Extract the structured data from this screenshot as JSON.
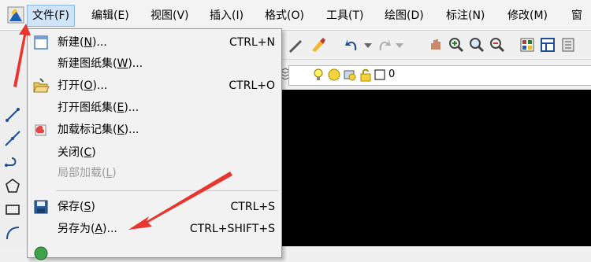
{
  "menubar": {
    "app_icon": "autocad-app-icon",
    "items": [
      {
        "label": "文件(F)"
      },
      {
        "label": "编辑(E)"
      },
      {
        "label": "视图(V)"
      },
      {
        "label": "插入(I)"
      },
      {
        "label": "格式(O)"
      },
      {
        "label": "工具(T)"
      },
      {
        "label": "绘图(D)"
      },
      {
        "label": "标注(N)"
      },
      {
        "label": "修改(M)"
      },
      {
        "label": "窗"
      }
    ]
  },
  "layer_toolbar": {
    "layer_name": "0"
  },
  "file_menu": {
    "items": [
      {
        "pre": "新建(",
        "key": "N",
        "post": ")...",
        "shortcut": "CTRL+N",
        "icon": "new-file-icon",
        "enabled": true
      },
      {
        "pre": "新建图纸集(",
        "key": "W",
        "post": ")...",
        "shortcut": "",
        "icon": "",
        "enabled": true
      },
      {
        "pre": "打开(",
        "key": "O",
        "post": ")...",
        "shortcut": "CTRL+O",
        "icon": "open-folder-icon",
        "enabled": true
      },
      {
        "pre": "打开图纸集(",
        "key": "E",
        "post": ")...",
        "shortcut": "",
        "icon": "",
        "enabled": true
      },
      {
        "pre": "加载标记集(",
        "key": "K",
        "post": ")...",
        "shortcut": "",
        "icon": "markup-set-icon",
        "enabled": true
      },
      {
        "pre": "关闭(",
        "key": "C",
        "post": ")",
        "shortcut": "",
        "icon": "",
        "enabled": true
      },
      {
        "pre": "局部加载(",
        "key": "L",
        "post": ")",
        "shortcut": "",
        "icon": "",
        "enabled": false
      },
      {
        "pre": "保存(",
        "key": "S",
        "post": ")",
        "shortcut": "CTRL+S",
        "icon": "save-disk-icon",
        "enabled": true
      },
      {
        "pre": "另存为(",
        "key": "A",
        "post": ")...",
        "shortcut": "CTRL+SHIFT+S",
        "icon": "",
        "enabled": true
      }
    ]
  },
  "colors": {
    "annotation_arrow": "#e8352e",
    "menu_highlight": "#cfe4f7",
    "canvas": "#000000"
  }
}
